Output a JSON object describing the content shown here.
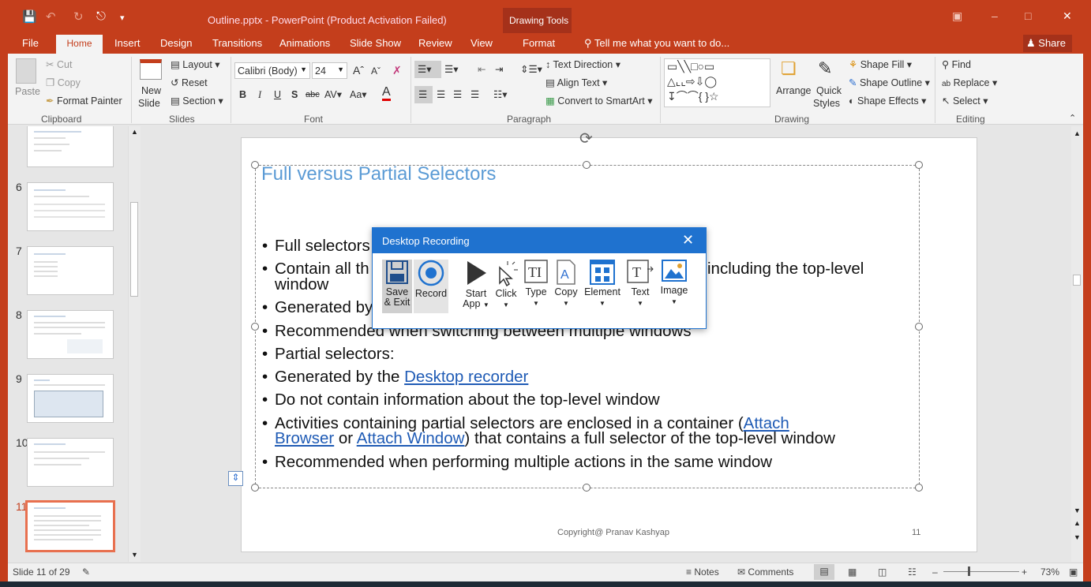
{
  "window": {
    "doc_title": "Outline.pptx - PowerPoint (Product Activation Failed)",
    "contextual_label": "Drawing Tools"
  },
  "tabs": [
    "File",
    "Home",
    "Insert",
    "Design",
    "Transitions",
    "Animations",
    "Slide Show",
    "Review",
    "View",
    "Format"
  ],
  "tell_me": "Tell me what you want to do...",
  "share": "Share",
  "ribbon": {
    "clipboard": {
      "paste": "Paste",
      "cut": "Cut",
      "copy": "Copy",
      "format_painter": "Format Painter",
      "group": "Clipboard"
    },
    "slides": {
      "new_slide_1": "New",
      "new_slide_2": "Slide",
      "layout": "Layout",
      "reset": "Reset",
      "section": "Section",
      "group": "Slides"
    },
    "font": {
      "family": "Calibri (Body)",
      "size": "24",
      "group": "Font"
    },
    "paragraph": {
      "text_direction": "Text Direction",
      "align_text": "Align Text",
      "convert_smartart": "Convert to SmartArt",
      "group": "Paragraph"
    },
    "drawing": {
      "arrange": "Arrange",
      "quick_styles_1": "Quick",
      "quick_styles_2": "Styles",
      "shape_fill": "Shape Fill",
      "shape_outline": "Shape Outline",
      "shape_effects": "Shape Effects",
      "group": "Drawing"
    },
    "editing": {
      "find": "Find",
      "replace": "Replace",
      "select": "Select",
      "group": "Editing"
    }
  },
  "thumbnails": [
    {
      "num": "6"
    },
    {
      "num": "7"
    },
    {
      "num": "8"
    },
    {
      "num": "9"
    },
    {
      "num": "10"
    },
    {
      "num": "11"
    }
  ],
  "slide": {
    "title": "Full versus Partial Selectors",
    "b1": "Full selectors",
    "b2a": "Contain all th",
    "b2b": "including the top-level",
    "b2c": "window",
    "b3": "Generated by",
    "b4": "Recommended when switching between multiple windows",
    "b5": "Partial selectors:",
    "b6a": "Generated by the ",
    "b6link": "Desktop recorder",
    "b7": "Do not contain information about the top-level window",
    "b8a": "Activities containing partial selectors are enclosed in a container (",
    "b8link1a": "Attach",
    "b8link1b": "Browser",
    "b8or": " or ",
    "b8link2": "Attach Window",
    "b8tail": ") that contains a full selector of the top-level window",
    "b9": "Recommended when performing multiple actions in the same window",
    "copyright": "Copyright@ Pranav Kashyap",
    "number": "11"
  },
  "dialog": {
    "title": "Desktop Recording",
    "save_1": "Save",
    "save_2": "& Exit",
    "record": "Record",
    "start_1": "Start",
    "start_2": "App",
    "click": "Click",
    "type": "Type",
    "copy": "Copy",
    "element": "Element",
    "text": "Text",
    "image": "Image"
  },
  "status": {
    "slide_of": "Slide 11 of 29",
    "notes": "Notes",
    "comments": "Comments",
    "zoom": "73%"
  },
  "colors": {
    "accent": "#c43e1c",
    "dialog": "#1f72cf",
    "title": "#5b9bd5",
    "link": "#1f5bb5"
  }
}
